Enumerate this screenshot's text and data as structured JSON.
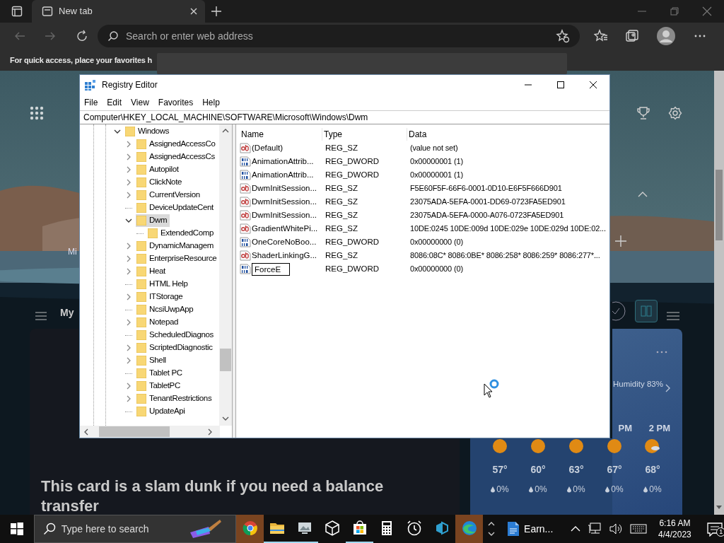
{
  "browser": {
    "tab": {
      "title": "New tab"
    },
    "address": {
      "placeholder": "Search or enter web address"
    },
    "favorites_hint": "For quick access, place your favorites h"
  },
  "new_tab_page": {
    "section_label": "Mi",
    "feed_label": "My",
    "news_card": {
      "headline": "This card is a slam dunk if you need a balance transfer"
    },
    "weather": {
      "humidity": "Humidity 83%",
      "hourly": [
        {
          "kind": "sun",
          "temp": "57°",
          "precip": "0%"
        },
        {
          "kind": "sun",
          "temp": "60°",
          "precip": "0%"
        },
        {
          "kind": "sun",
          "temp": "63°",
          "precip": "0%"
        },
        {
          "kind": "sun",
          "hour": "PM",
          "temp": "67°",
          "precip": "0%"
        },
        {
          "kind": "partly-cloudy",
          "hour": "2 PM",
          "temp": "68°",
          "precip": "0%"
        }
      ]
    }
  },
  "registry_editor": {
    "title": "Registry Editor",
    "menu": [
      "File",
      "Edit",
      "View",
      "Favorites",
      "Help"
    ],
    "address": "Computer\\HKEY_LOCAL_MACHINE\\SOFTWARE\\Microsoft\\Windows\\Dwm",
    "tree": [
      {
        "label": "Windows",
        "expanded": true,
        "selected": false,
        "children": [
          {
            "label": "AssignedAccessCo",
            "expanded": false,
            "selected": false
          },
          {
            "label": "AssignedAccessCs",
            "expanded": false,
            "selected": false
          },
          {
            "label": "Autopilot",
            "expanded": false,
            "selected": false
          },
          {
            "label": "ClickNote",
            "expanded": false,
            "selected": false
          },
          {
            "label": "CurrentVersion",
            "expanded": false,
            "selected": false
          },
          {
            "label": "DeviceUpdateCent",
            "selected": false
          },
          {
            "label": "Dwm",
            "expanded": true,
            "selected": true,
            "children": [
              {
                "label": "ExtendedComp",
                "selected": false
              }
            ]
          },
          {
            "label": "DynamicManagem",
            "expanded": false,
            "selected": false
          },
          {
            "label": "EnterpriseResource",
            "expanded": false,
            "selected": false
          },
          {
            "label": "Heat",
            "expanded": false,
            "selected": false
          },
          {
            "label": "HTML Help",
            "selected": false
          },
          {
            "label": "ITStorage",
            "expanded": false,
            "selected": false
          },
          {
            "label": "NcsiUwpApp",
            "selected": false
          },
          {
            "label": "Notepad",
            "expanded": false,
            "selected": false
          },
          {
            "label": "ScheduledDiagnos",
            "selected": false
          },
          {
            "label": "ScriptedDiagnostic",
            "expanded": false,
            "selected": false
          },
          {
            "label": "Shell",
            "expanded": false,
            "selected": false
          },
          {
            "label": "Tablet PC",
            "selected": false
          },
          {
            "label": "TabletPC",
            "expanded": false,
            "selected": false
          },
          {
            "label": "TenantRestrictions",
            "expanded": false,
            "selected": false
          },
          {
            "label": "UpdateApi",
            "selected": false
          }
        ]
      }
    ],
    "columns": [
      "Name",
      "Type",
      "Data"
    ],
    "values": [
      {
        "kind": "string",
        "name": "(Default)",
        "type": "REG_SZ",
        "data": "(value not set)",
        "editing": false
      },
      {
        "kind": "dword",
        "name": "AnimationAttrib...",
        "type": "REG_DWORD",
        "data": "0x00000001 (1)",
        "editing": false
      },
      {
        "kind": "dword",
        "name": "AnimationAttrib...",
        "type": "REG_DWORD",
        "data": "0x00000001 (1)",
        "editing": false
      },
      {
        "kind": "string",
        "name": "DwmInitSession...",
        "type": "REG_SZ",
        "data": "F5E60F5F-66F6-0001-0D10-E6F5F666D901",
        "editing": false
      },
      {
        "kind": "string",
        "name": "DwmInitSession...",
        "type": "REG_SZ",
        "data": "23075ADA-5EFA-0001-DD69-0723FA5ED901",
        "editing": false
      },
      {
        "kind": "string",
        "name": "DwmInitSession...",
        "type": "REG_SZ",
        "data": "23075ADA-5EFA-0000-A076-0723FA5ED901",
        "editing": false
      },
      {
        "kind": "string",
        "name": "GradientWhitePi...",
        "type": "REG_SZ",
        "data": "10DE:0245 10DE:009d 10DE:029e 10DE:029d 10DE:02...",
        "editing": false
      },
      {
        "kind": "dword",
        "name": "OneCoreNoBoo...",
        "type": "REG_DWORD",
        "data": "0x00000000 (0)",
        "editing": false
      },
      {
        "kind": "string",
        "name": "ShaderLinkingG...",
        "type": "REG_SZ",
        "data": "8086:08C* 8086:0BE* 8086:258* 8086:259* 8086:277*...",
        "editing": false
      },
      {
        "kind": "dword",
        "name": "ForceE",
        "type": "REG_DWORD",
        "data": "0x00000000 (0)",
        "editing": true
      }
    ]
  },
  "taskbar": {
    "search": {
      "placeholder": "Type here to search"
    },
    "apps": [
      {
        "kind": "chrome",
        "highlighted": true,
        "running": false
      },
      {
        "kind": "explorer",
        "highlighted": false,
        "running": true
      },
      {
        "kind": "photos",
        "highlighted": false,
        "running": true
      },
      {
        "kind": "cube",
        "highlighted": false,
        "running": false
      },
      {
        "kind": "store",
        "highlighted": false,
        "running": true
      },
      {
        "kind": "calculator",
        "highlighted": false,
        "running": false
      },
      {
        "kind": "clock",
        "highlighted": false,
        "running": false
      },
      {
        "kind": "app",
        "highlighted": false,
        "running": false
      },
      {
        "kind": "edge",
        "highlighted": true,
        "running": false
      }
    ],
    "document": {
      "label": "Earn..."
    },
    "clock": {
      "time": "6:16 AM",
      "date": "4/4/2023"
    },
    "notifications": {
      "count": "1"
    }
  }
}
